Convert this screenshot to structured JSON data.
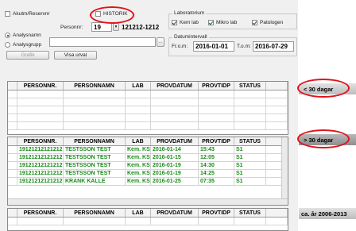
{
  "top": {
    "akut_label": "Akutm/Reservnr",
    "historik_label": "HISTORIK",
    "personnr_label": "Personnr:",
    "century": "19",
    "personnr": "121212-1212",
    "search_mode_name": "Analysnamn",
    "search_mode_group": "Analysgrupp",
    "graph_button": "Grafik",
    "show_selection_button": "Visa urval"
  },
  "laboratorium": {
    "title": "Laboratorium",
    "kem": "Kem lab",
    "mikro": "Mikro lab",
    "patologen": "Patologen"
  },
  "datumintervall": {
    "title": "Datumintervall",
    "from_label": "Fr.o.m:",
    "from": "2016-01-01",
    "to_label": "T.o.m:",
    "to": "2016-07-29"
  },
  "columns": [
    "PERSONNR.",
    "PERSONNAMN",
    "LAB",
    "PROVDATUM",
    "PROVTIDP",
    "STATUS"
  ],
  "tags": {
    "lt30": "< 30 dagar",
    "gt30": "> 30 dagar",
    "ca2006": "ca. år 2006-2013"
  },
  "rows": [
    [
      "19121212121212",
      "TESTSSON TEST",
      "Kem. KS",
      "2016-01-14",
      "15:43",
      "S1"
    ],
    [
      "19121212121212",
      "TESTSSON TEST",
      "Kem. KS",
      "2016-01-15",
      "12:05",
      "S1"
    ],
    [
      "19121212121212",
      "TESTSSON TEST",
      "Kem. KS",
      "2016-01-19",
      "14:30",
      "S1"
    ],
    [
      "19121212121212",
      "TESTSSON TEST",
      "Kem. KS",
      "2016-01-19",
      "14:25",
      "S1"
    ],
    [
      "19121212121212",
      "KRANK KALLE",
      "Kem. KS",
      "2016-01-25",
      "07:35",
      "S1"
    ]
  ]
}
